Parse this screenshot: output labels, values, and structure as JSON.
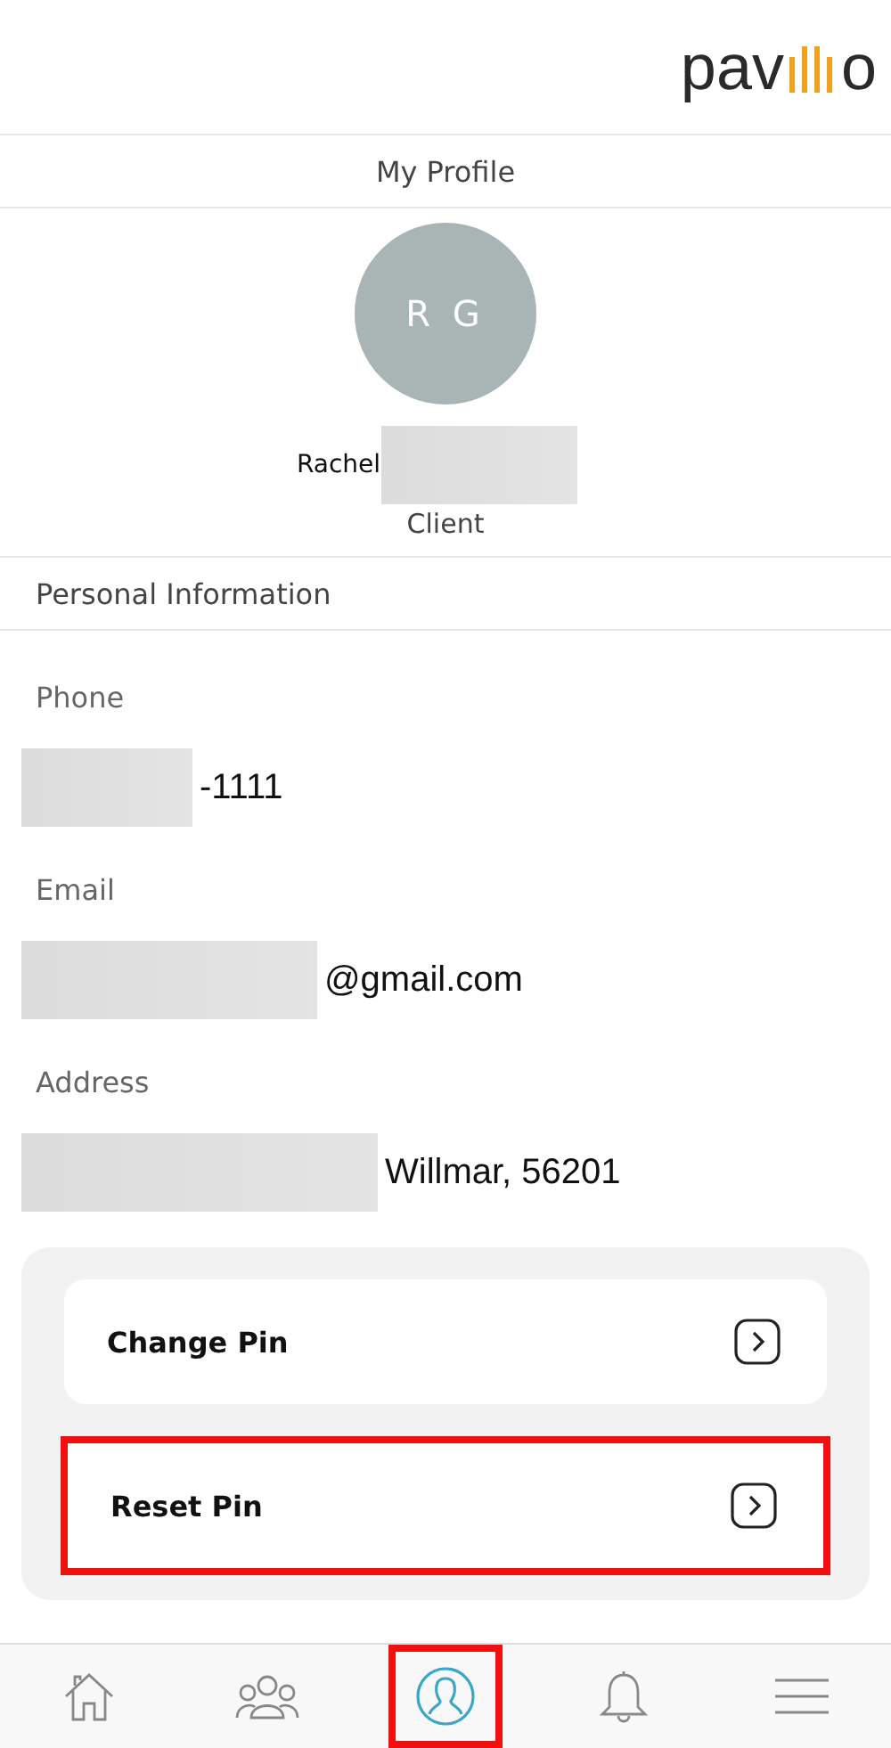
{
  "logo": {
    "start": "pav",
    "end": "o"
  },
  "title": "My Profile",
  "profile": {
    "initials": "R G",
    "first_name": "Rachel",
    "name_redacted": true,
    "role": "Client"
  },
  "section_title": "Personal Information",
  "fields": [
    {
      "label": "Phone",
      "value": "-1111",
      "redacted": true
    },
    {
      "label": "Email",
      "value": "@gmail.com",
      "redacted": true
    },
    {
      "label": "Address",
      "value": "Willmar, 56201",
      "redacted": true
    }
  ],
  "actions": [
    {
      "label": "Change Pin",
      "highlighted": false
    },
    {
      "label": "Reset Pin",
      "highlighted": true
    }
  ],
  "nav": [
    {
      "kind": "home",
      "selected": false,
      "highlighted": false
    },
    {
      "kind": "group",
      "selected": false,
      "highlighted": false
    },
    {
      "kind": "profile",
      "selected": true,
      "highlighted": true
    },
    {
      "kind": "bell",
      "selected": false,
      "highlighted": false
    },
    {
      "kind": "menu",
      "selected": false,
      "highlighted": false
    }
  ]
}
